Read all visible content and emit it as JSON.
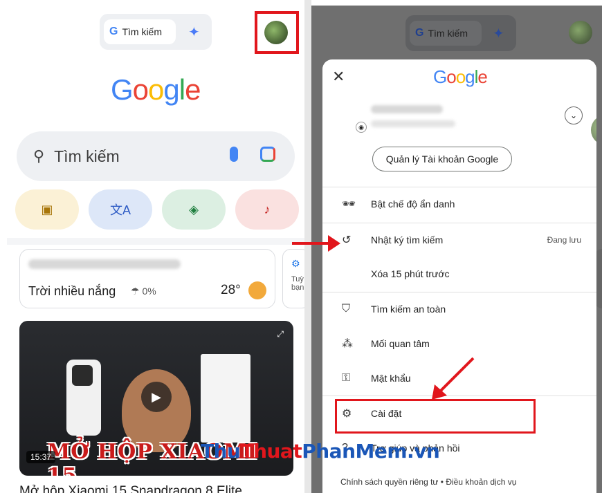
{
  "left": {
    "search_pill_label": "Tìm kiếm",
    "google_logo": [
      "G",
      "o",
      "o",
      "g",
      "l",
      "e"
    ],
    "search_placeholder": "Tìm kiếm",
    "chips": [
      "image-search-icon",
      "translate-icon",
      "school-icon",
      "music-note-icon"
    ],
    "weather": {
      "condition": "Trời nhiều nắng",
      "rain": "0%",
      "temp": "28°"
    },
    "side_card_text": "Tuỳ bạn",
    "video": {
      "duration": "15:37",
      "overlay": "MỞ HỘP XIAOMI 15"
    },
    "caption": "Mở hộp Xiaomi 15 Snapdragon 8 Elite"
  },
  "right": {
    "search_pill_label": "Tìm kiếm",
    "sheet": {
      "google_logo": [
        "G",
        "o",
        "o",
        "g",
        "l",
        "e"
      ],
      "manage_account": "Quản lý Tài khoản Google",
      "menu": [
        {
          "icon": "incognito-icon",
          "label": "Bật chế độ ẩn danh",
          "right": ""
        },
        {
          "icon": "history-icon",
          "label": "Nhật ký tìm kiếm",
          "right": "Đang lưu"
        },
        {
          "icon": "",
          "label": "Xóa 15 phút trước",
          "right": ""
        },
        {
          "icon": "safe-search-icon",
          "label": "Tìm kiếm an toàn",
          "right": ""
        },
        {
          "icon": "interests-icon",
          "label": "Mối quan tâm",
          "right": ""
        },
        {
          "icon": "key-icon",
          "label": "Mật khẩu",
          "right": ""
        },
        {
          "icon": "gear-icon",
          "label": "Cài đặt",
          "right": ""
        },
        {
          "icon": "help-icon",
          "label": "Trợ giúp và phản hồi",
          "right": ""
        }
      ],
      "footer": "Chính sách quyền riêng tư  •  Điều khoản dịch vụ"
    }
  },
  "watermark": {
    "part1": "Thu",
    "part2": "Thuat",
    "part3": "PhanMem",
    "part4": ".vn"
  }
}
